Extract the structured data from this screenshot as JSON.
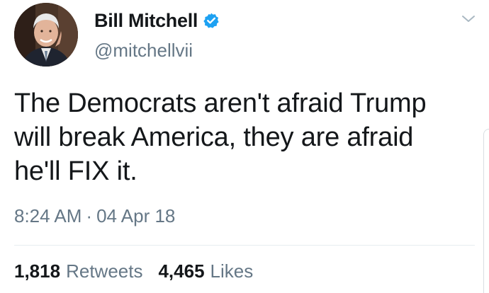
{
  "author": {
    "display_name": "Bill Mitchell",
    "handle": "@mitchellvii",
    "verified": true,
    "avatar_icon": "profile-photo",
    "verified_icon": "verified-badge-icon"
  },
  "tweet": {
    "text": "The Democrats aren't afraid Trump\nwill break America, they are afraid\nhe'll FIX it.",
    "time": "8:24 AM",
    "separator": "·",
    "date": "04 Apr 18"
  },
  "stats": {
    "retweets_count": "1,818",
    "retweets_label": "Retweets",
    "likes_count": "4,465",
    "likes_label": "Likes"
  },
  "colors": {
    "text_primary": "#14171a",
    "text_secondary": "#657786",
    "verified_blue": "#1da1f2",
    "divider": "#e6ecf0"
  }
}
